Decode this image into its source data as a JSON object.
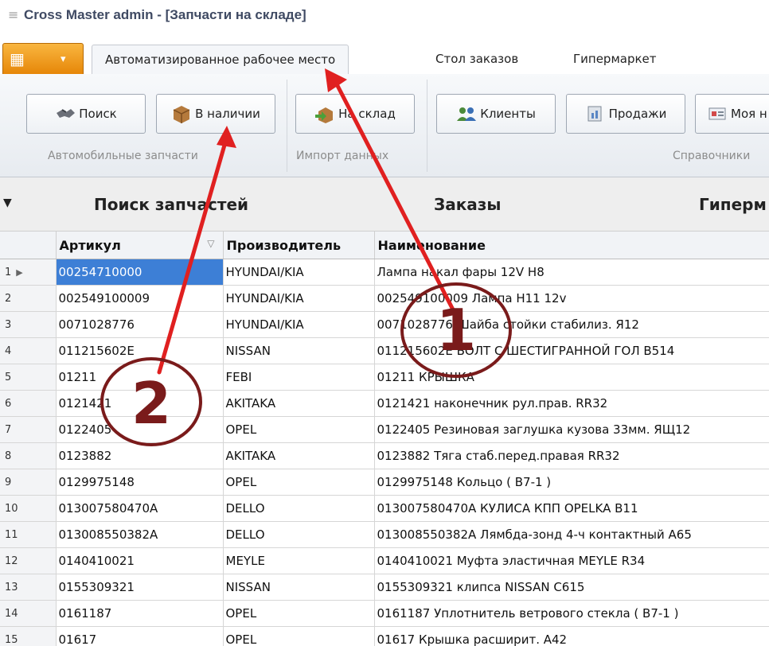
{
  "window": {
    "title": "Cross Master admin - [Запчасти на складе]",
    "menu_icon": "hamburger-icon"
  },
  "app_button": {
    "icon": "grid-icon",
    "caret": "▾"
  },
  "tabs": [
    {
      "label": "Автоматизированное рабочее место",
      "active": true
    },
    {
      "label": "Стол заказов",
      "active": false
    },
    {
      "label": "Гипермаркет",
      "active": false
    }
  ],
  "ribbon": {
    "buttons": [
      {
        "label": "Поиск",
        "icon": "handshake-icon"
      },
      {
        "label": "В наличии",
        "icon": "box-icon"
      },
      {
        "label": "На склад",
        "icon": "import-box-icon"
      },
      {
        "label": "Клиенты",
        "icon": "users-icon"
      },
      {
        "label": "Продажи",
        "icon": "sales-icon"
      },
      {
        "label": "Моя н",
        "icon": "card-icon"
      }
    ],
    "groups": [
      {
        "label": "Автомобильные запчасти"
      },
      {
        "label": "Импорт данных"
      },
      {
        "label": "Справочники"
      }
    ]
  },
  "sections": [
    {
      "label": "Поиск запчастей"
    },
    {
      "label": "Заказы"
    },
    {
      "label": "Гиперм"
    }
  ],
  "grid": {
    "columns": [
      "Артикул",
      "Производитель",
      "Наименование"
    ],
    "rows": [
      {
        "n": "1",
        "article": "00254710000",
        "maker": "HYUNDAI/KIA",
        "name": "Лампа накал фары 12V H8",
        "selected": true
      },
      {
        "n": "2",
        "article": "002549100009",
        "maker": "HYUNDAI/KIA",
        "name": "002549100009 Лампа H11 12v"
      },
      {
        "n": "3",
        "article": "0071028776",
        "maker": "HYUNDAI/KIA",
        "name": "0071028776 Шайба стойки стабилиз. Я12"
      },
      {
        "n": "4",
        "article": "011215602E",
        "maker": "NISSAN",
        "name": "011215602E БОЛТ С ШЕСТИГРАННОЙ ГОЛ B514"
      },
      {
        "n": "5",
        "article": "01211",
        "maker": "FEBI",
        "name": "01211 КРЫШКА"
      },
      {
        "n": "6",
        "article": "0121421",
        "maker": "AKITAKA",
        "name": "0121421 наконечник рул.прав. RR32"
      },
      {
        "n": "7",
        "article": "0122405",
        "maker": "OPEL",
        "name": "0122405 Резиновая заглушка кузова 33мм. ЯЩ12"
      },
      {
        "n": "8",
        "article": "0123882",
        "maker": "AKITAKA",
        "name": "0123882 Тяга стаб.перед.правая  RR32"
      },
      {
        "n": "9",
        "article": "0129975148",
        "maker": "OPEL",
        "name": "0129975148 Кольцо  ( B7-1 )"
      },
      {
        "n": "10",
        "article": "013007580470A",
        "maker": "DELLO",
        "name": "013007580470A КУЛИСА КПП OPELKA B11"
      },
      {
        "n": "11",
        "article": "013008550382A",
        "maker": "DELLO",
        "name": "013008550382A Лямбда-зонд 4-ч контактный  A65"
      },
      {
        "n": "12",
        "article": "0140410021",
        "maker": "MEYLE",
        "name": "0140410021 Муфта эластичная MEYLE R34"
      },
      {
        "n": "13",
        "article": "0155309321",
        "maker": "NISSAN",
        "name": "0155309321 клипса NISSAN C615"
      },
      {
        "n": "14",
        "article": "0161187",
        "maker": "OPEL",
        "name": "0161187 Уплотнитель ветрового стекла  ( B7-1 )"
      },
      {
        "n": "15",
        "article": "01617",
        "maker": "OPEL",
        "name": "01617 Крышка расширит. А42"
      }
    ]
  },
  "annotations": {
    "color": "#e02020",
    "circle_color": "#7a1b1b",
    "markers": [
      {
        "label": "1"
      },
      {
        "label": "2"
      }
    ]
  }
}
